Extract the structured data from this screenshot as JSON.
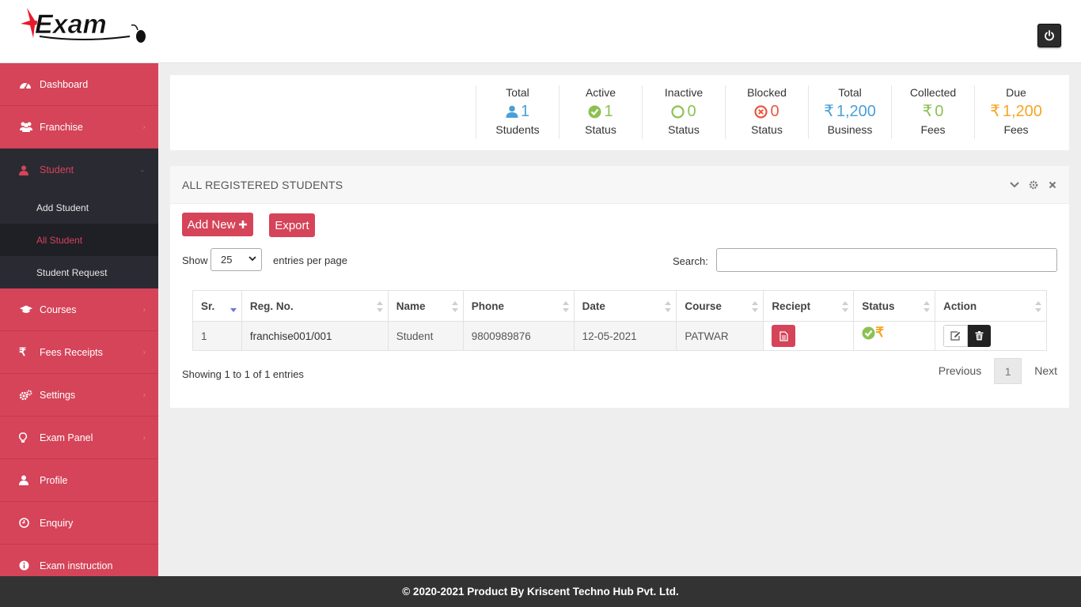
{
  "header": {
    "logo_text": "kExam",
    "power_icon": "power-icon"
  },
  "sidebar": {
    "items": [
      {
        "label": "Dashboard",
        "icon": "dashboard-icon"
      },
      {
        "label": "Franchise",
        "icon": "users-icon"
      },
      {
        "label": "Student",
        "icon": "user-icon",
        "expanded": true,
        "children": [
          "Add Student",
          "All Student",
          "Student Request"
        ],
        "current": "All Student"
      },
      {
        "label": "Courses",
        "icon": "graduation-cap-icon"
      },
      {
        "label": "Fees Receipts",
        "icon": "rupee-icon"
      },
      {
        "label": "Settings",
        "icon": "cogs-icon"
      },
      {
        "label": "Exam Panel",
        "icon": "lightbulb-icon"
      },
      {
        "label": "Profile",
        "icon": "user-icon"
      },
      {
        "label": "Enquiry",
        "icon": "clock-icon"
      },
      {
        "label": "Exam instruction",
        "icon": "info-icon"
      }
    ]
  },
  "stats": [
    {
      "label": "Total",
      "value": "1",
      "sub": "Students",
      "icon": "user-icon",
      "color": "#4a9fd8"
    },
    {
      "label": "Active",
      "value": "1",
      "sub": "Status",
      "icon": "check-circle-icon",
      "color": "#8cc152"
    },
    {
      "label": "Inactive",
      "value": "0",
      "sub": "Status",
      "icon": "circle-icon",
      "color": "#8cc152"
    },
    {
      "label": "Blocked",
      "value": "0",
      "sub": "Status",
      "icon": "times-circle-icon",
      "color": "#e9573f"
    },
    {
      "label": "Total",
      "value": "1,200",
      "sub": "Business",
      "icon": "rupee-icon",
      "color": "#4a9fd8"
    },
    {
      "label": "Collected",
      "value": "0",
      "sub": "Fees",
      "icon": "rupee-icon",
      "color": "#8cc152"
    },
    {
      "label": "Due",
      "value": "1,200",
      "sub": "Fees",
      "icon": "rupee-icon",
      "color": "#f6a623"
    }
  ],
  "panel": {
    "title": "ALL REGISTERED STUDENTS",
    "add_new_label": "Add New",
    "export_label": "Export",
    "show_label": "Show",
    "entries_value": "25",
    "entries_label": "entries per page",
    "search_label": "Search:",
    "search_value": ""
  },
  "table": {
    "columns": [
      "Sr.",
      "Reg. No.",
      "Name",
      "Phone",
      "Date",
      "Course",
      "Reciept",
      "Status",
      "Action"
    ],
    "rows": [
      {
        "sr": "1",
        "reg": "franchise001/001",
        "name": "Student",
        "phone": "9800989876",
        "date": "12-05-2021",
        "course": "PATWAR"
      }
    ]
  },
  "pagination": {
    "info": "Showing 1 to 1 of 1 entries",
    "previous": "Previous",
    "current": "1",
    "next": "Next"
  },
  "footer": {
    "text": "© 2020-2021 Product By Kriscent Techno Hub Pvt. Ltd."
  },
  "colors": {
    "brand": "#d54459",
    "sidebar_dark": "#2a2a33",
    "footer": "#333333"
  }
}
